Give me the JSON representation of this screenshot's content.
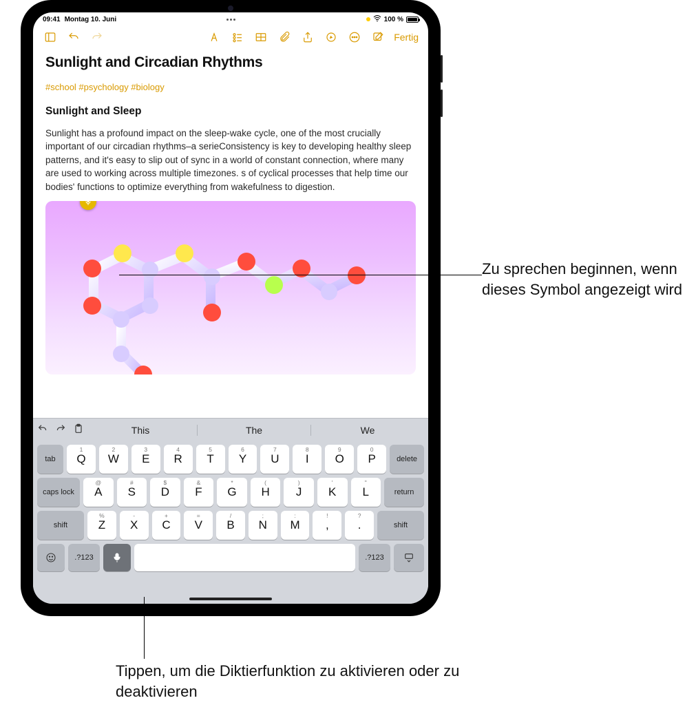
{
  "status": {
    "time": "09:41",
    "date": "Montag 10. Juni",
    "battery_pct": "100 %"
  },
  "toolbar": {
    "done_label": "Fertig"
  },
  "note": {
    "title": "Sunlight and Circadian Rhythms",
    "tags": "#school #psychology #biology",
    "heading": "Sunlight and Sleep",
    "paragraph": "Sunlight has a profound impact on the sleep-wake cycle, one of the most crucially important of our circadian rhythms–a serieConsistency is key to developing healthy sleep patterns, and it's easy to slip out of sync in a world of constant connection, where many are used to working across multiple timezones. s of cyclical processes that help time our bodies' functions to optimize everything from wakefulness to digestion."
  },
  "keyboard": {
    "suggestions": [
      "This",
      "The",
      "We"
    ],
    "row1_alts": [
      "1",
      "2",
      "3",
      "4",
      "5",
      "6",
      "7",
      "8",
      "9",
      "0"
    ],
    "row1": [
      "Q",
      "W",
      "E",
      "R",
      "T",
      "Y",
      "U",
      "I",
      "O",
      "P"
    ],
    "row2_alts": [
      "@",
      "#",
      "$",
      "&",
      "*",
      "(",
      ")",
      "'",
      "\""
    ],
    "row2": [
      "A",
      "S",
      "D",
      "F",
      "G",
      "H",
      "J",
      "K",
      "L"
    ],
    "row3_alts": [
      "%",
      "-",
      "+",
      "=",
      "/",
      ";",
      ":",
      "!",
      "?"
    ],
    "row3": [
      "Z",
      "X",
      "C",
      "V",
      "B",
      "N",
      "M",
      ",",
      "."
    ],
    "tab": "tab",
    "delete": "delete",
    "capslock": "caps lock",
    "return": "return",
    "shift": "shift",
    "numsym": ".?123"
  },
  "callouts": {
    "c1": "Zu sprechen beginnen, wenn dieses Symbol angezeigt wird",
    "c2": "Tippen, um die Diktierfunktion zu aktivieren oder zu deaktivieren"
  }
}
